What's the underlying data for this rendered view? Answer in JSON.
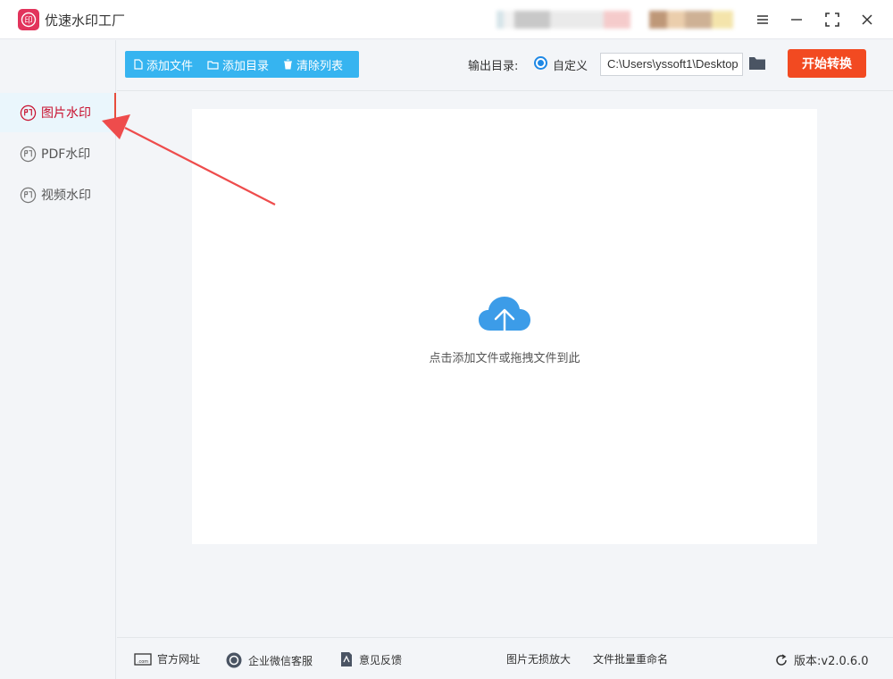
{
  "app": {
    "title": "优速水印工厂",
    "logo_text": "印"
  },
  "window_controls": {
    "menu_icon": "menu-icon",
    "minimize_icon": "minimize-icon",
    "maximize_icon": "maximize-icon",
    "close_icon": "close-icon"
  },
  "sidebar": {
    "items": [
      {
        "label": "图片水印",
        "active": true,
        "icon": "stamp-icon"
      },
      {
        "label": "PDF水印",
        "active": false,
        "icon": "stamp-icon"
      },
      {
        "label": "视频水印",
        "active": false,
        "icon": "stamp-icon"
      }
    ]
  },
  "toolbar": {
    "add_file": "添加文件",
    "add_folder": "添加目录",
    "clear_list": "清除列表"
  },
  "output": {
    "label": "输出目录:",
    "option_label": "自定义",
    "path": "C:\\Users\\yssoft1\\Desktop",
    "start_button": "开始转换"
  },
  "dropzone": {
    "text": "点击添加文件或拖拽文件到此"
  },
  "statusbar": {
    "website": "官方网址",
    "wechat_support": "企业微信客服",
    "feedback": "意见反馈",
    "image_enlarge": "图片无损放大",
    "batch_rename": "文件批量重命名",
    "version": "版本:v2.0.6.0"
  },
  "colors": {
    "accent_blue": "#36b4f0",
    "start_red": "#f24a21",
    "active_red": "#c8102e",
    "logo": "#e2345c"
  }
}
